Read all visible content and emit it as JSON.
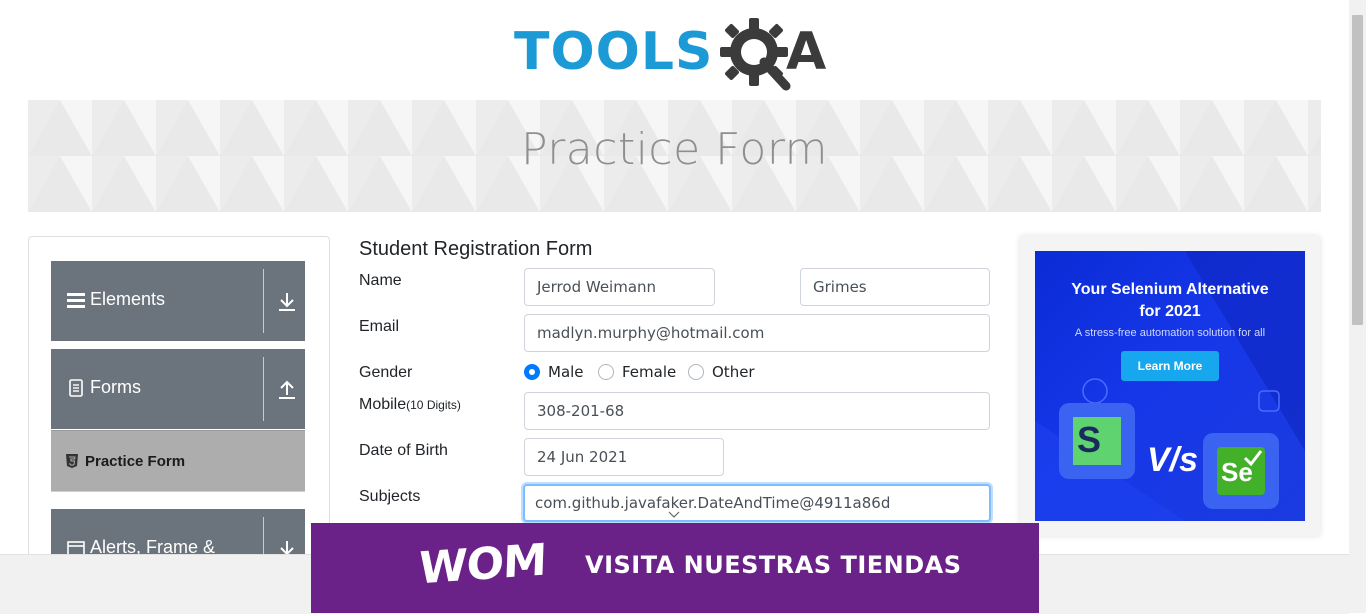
{
  "header": {
    "logo_text": "TOOLS",
    "logo_q": "Q",
    "logo_a": "A"
  },
  "banner": {
    "title": "Practice Form"
  },
  "sidebar": {
    "groups": [
      {
        "label": "Elements",
        "icon": "list-icon",
        "arrow": "download-arrow-icon"
      },
      {
        "label": "Forms",
        "icon": "document-icon",
        "arrow": "upload-arrow-icon"
      },
      {
        "label": "Alerts, Frame &",
        "icon": "window-icon",
        "arrow": "download-arrow-icon"
      }
    ],
    "active_item": {
      "label": "Practice Form",
      "icon": "html5-icon"
    }
  },
  "form": {
    "title": "Student Registration Form",
    "name_label": "Name",
    "first_name": "Jerrod Weimann",
    "last_name": "Grimes",
    "email_label": "Email",
    "email": "madlyn.murphy@hotmail.com",
    "gender_label": "Gender",
    "gender_options": [
      "Male",
      "Female",
      "Other"
    ],
    "gender_selected": "Male",
    "mobile_label": "Mobile",
    "mobile_hint": "(10 Digits)",
    "mobile": "308-201-68",
    "dob_label": "Date of Birth",
    "dob": "24 Jun 2021",
    "subjects_label": "Subjects",
    "subjects": "com.github.javafaker.DateAndTime@4911a86d"
  },
  "right_ad": {
    "headline_1": "Your Selenium Alternative",
    "headline_2": "for 2021",
    "subtext": "A stress-free automation solution for all",
    "button": "Learn More",
    "vs": "V/s",
    "left_logo": "S",
    "right_logo": "Se"
  },
  "bottom_ad": {
    "brand": "WOM",
    "text": "VISITA NUESTRAS TIENDAS"
  },
  "colors": {
    "brand_blue": "#1b9ad6",
    "sidebar_group": "#6b747c",
    "sidebar_active": "#adadad",
    "radio_checked": "#007bff",
    "bottom_ad_bg": "#6a2289"
  }
}
